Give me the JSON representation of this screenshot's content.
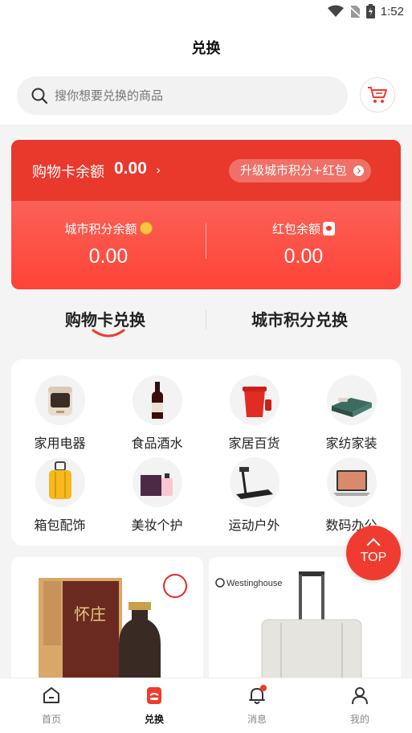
{
  "status_bar": {
    "time": "1:52"
  },
  "header": {
    "title": "兑换"
  },
  "search": {
    "placeholder": "搜你想要兑换的商品"
  },
  "card": {
    "balance_label": "购物卡余额",
    "balance_value": "0.00",
    "upgrade_label": "升级城市积分+红包",
    "city_points_label": "城市积分余额",
    "city_points_value": "0.00",
    "red_packet_label": "红包余额",
    "red_packet_value": "0.00"
  },
  "tabs": [
    {
      "label": "购物卡兑换",
      "active": true
    },
    {
      "label": "城市积分兑换",
      "active": false
    }
  ],
  "categories": [
    {
      "label": "家用电器",
      "icon": "air-fryer"
    },
    {
      "label": "食品酒水",
      "icon": "wine-bottle"
    },
    {
      "label": "家居百货",
      "icon": "red-bucket"
    },
    {
      "label": "家纺家装",
      "icon": "bed"
    },
    {
      "label": "箱包配饰",
      "icon": "suitcase"
    },
    {
      "label": "美妆个护",
      "icon": "perfume"
    },
    {
      "label": "运动户外",
      "icon": "treadmill"
    },
    {
      "label": "数码办公",
      "icon": "laptop"
    }
  ],
  "products": [
    {
      "image": "liquor-gift-box",
      "brand_text": "怀庄"
    },
    {
      "image": "luggage",
      "brand_text": "Westinghouse"
    }
  ],
  "top_button": {
    "label": "TOP"
  },
  "bottom_nav": [
    {
      "label": "首页",
      "icon": "home-icon",
      "active": false
    },
    {
      "label": "兑换",
      "icon": "exchange-icon",
      "active": true
    },
    {
      "label": "消息",
      "icon": "bell-icon",
      "active": false,
      "badge": true
    },
    {
      "label": "我的",
      "icon": "user-icon",
      "active": false
    }
  ],
  "colors": {
    "accent": "#ef3b2f",
    "background": "#f4f4f4"
  }
}
